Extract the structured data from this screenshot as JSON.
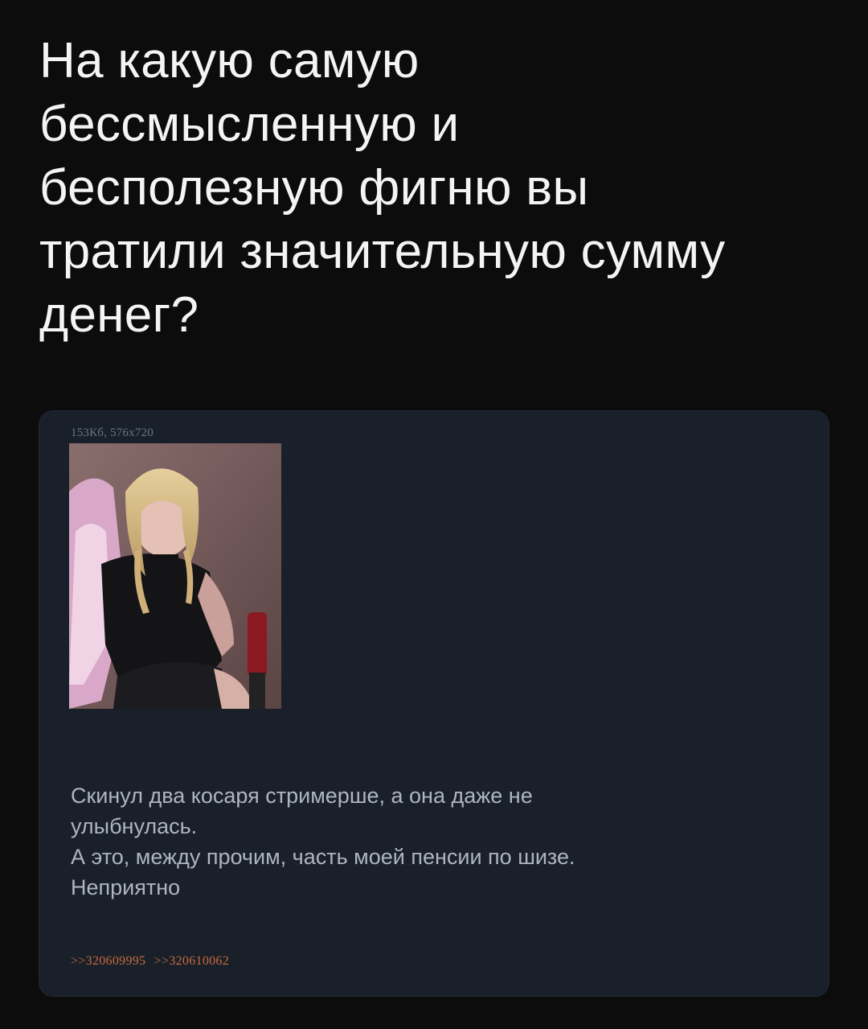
{
  "headline": {
    "lines": [
      "На какую самую",
      "бессмысленную и",
      "бесполезную фигню вы",
      "тратили значительную сумму",
      "денег?"
    ]
  },
  "post": {
    "file_meta": "153Кб, 576x720",
    "image_alt": "photo-thumbnail",
    "text_lines": [
      "Скинул два косаря стримерше, а она даже не",
      "улыбнулась.",
      "А это, между прочим, часть моей пенсии по шизе.",
      "Неприятно"
    ],
    "reply_links": [
      ">>320609995",
      ">>320610062"
    ]
  },
  "colors": {
    "background": "#0c0c0c",
    "card": "#19202a",
    "headline_text": "#f4f4f4",
    "post_text": "#aeb5bf",
    "meta_text": "#6b7482",
    "reply_link": "#c96a3c"
  }
}
